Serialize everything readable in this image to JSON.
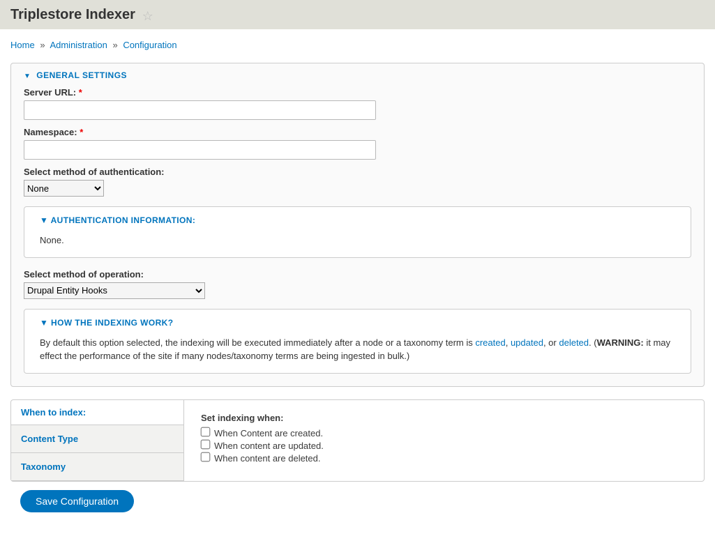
{
  "page_title": "Triplestore Indexer",
  "breadcrumb": {
    "home": "Home",
    "admin": "Administration",
    "config": "Configuration"
  },
  "general": {
    "legend": "General Settings",
    "server_url_label": "Server URL:",
    "server_url_value": "",
    "namespace_label": "Namespace:",
    "namespace_value": "",
    "auth_method_label": "Select method of authentication:",
    "auth_method_value": "None",
    "auth_info_legend": "Authentication Information:",
    "auth_info_body": "None.",
    "op_method_label": "Select method of operation:",
    "op_method_value": "Drupal Entity Hooks",
    "how_works_legend": "How the Indexing work?",
    "how_works_text_1": "By default this option selected, the indexing will be executed immediately after a node or a taxonomy term is ",
    "how_works_created": "created",
    "how_works_updated": "updated",
    "how_works_or": ", or ",
    "how_works_deleted": "deleted",
    "how_works_text_2": ". (",
    "how_works_warning_label": "WARNING:",
    "how_works_text_3": " it may effect the performance of the site if many nodes/taxonomy terms are being ingested in bulk.)"
  },
  "tabs": {
    "header": "When to index:",
    "items": [
      "Content Type",
      "Taxonomy"
    ],
    "content": {
      "heading": "Set indexing when:",
      "options": [
        "When Content are created.",
        "When content are updated.",
        "When content are deleted."
      ]
    }
  },
  "save_button": "Save Configuration"
}
